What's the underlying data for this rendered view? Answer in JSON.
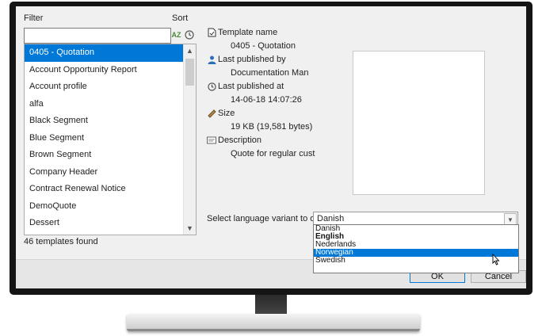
{
  "filter": {
    "label": "Filter",
    "value": "",
    "sort_label": "Sort"
  },
  "sort_icons": {
    "alpha": "AZ",
    "alpha_icon": "sort-az-icon",
    "time_icon": "clock-icon"
  },
  "templates": [
    "0405 - Quotation",
    "Account Opportunity Report",
    "Account profile",
    "alfa",
    "Black Segment",
    "Blue Segment",
    "Brown Segment",
    "Company Header",
    "Contract Renewal Notice",
    "DemoQuote",
    "Dessert"
  ],
  "selected_template": "0405 - Quotation",
  "templates_found": "46 templates found",
  "details": {
    "template_name_label": "Template name",
    "template_name": "0405 - Quotation",
    "published_by_label": "Last published by",
    "published_by": "Documentation Man",
    "published_at_label": "Last published at",
    "published_at": "14-06-18 14:07:26",
    "size_label": "Size",
    "size": "19 KB (19,581 bytes)",
    "description_label": "Description",
    "description": "Quote for regular cust"
  },
  "language": {
    "label": "Select language variant to open:",
    "selected": "Danish",
    "options": [
      "Danish",
      "English",
      "Nederlands",
      "Norwegian",
      "Swedish"
    ],
    "highlighted": "Norwegian",
    "bold": "English"
  },
  "buttons": {
    "ok": "OK",
    "cancel": "Cancel"
  },
  "colors": {
    "selection": "#0078d7",
    "bezel": "#151515"
  }
}
